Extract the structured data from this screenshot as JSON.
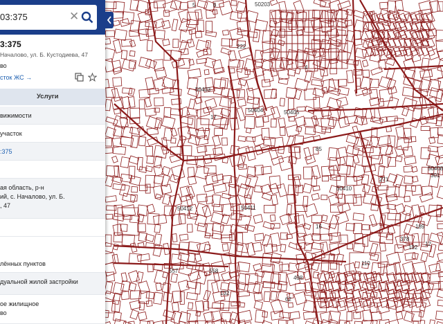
{
  "search": {
    "value": "03:375",
    "clear_icon": "close-icon",
    "search_icon": "search-icon"
  },
  "card": {
    "title": "3:375",
    "address": "Началово, ул. Б. Кустодиева, 47",
    "subtitle": "во",
    "link": "сток ЖС →",
    "actions": [
      "copy-icon",
      "star-icon"
    ]
  },
  "tabs": {
    "services": "Услуги"
  },
  "rows": [
    {
      "lines": [
        "вижимости"
      ],
      "alt": true
    },
    {
      "lines": [
        "участок"
      ],
      "alt": false
    },
    {
      "lines": [
        ":375"
      ],
      "alt": true,
      "blue": true
    },
    {
      "lines": [],
      "alt": false
    },
    {
      "lines": [
        "ая область, р-н",
        "ий, с. Началово, ул. Б.",
        ", 47"
      ],
      "alt": true
    },
    {
      "lines": [],
      "alt": false
    },
    {
      "lines": [
        "лённых пунктов"
      ],
      "alt": false
    },
    {
      "lines": [
        "дуальной жилой застройки"
      ],
      "alt": true
    },
    {
      "lines": [
        "ое жилищное",
        "во"
      ],
      "alt": false
    }
  ],
  "map": {
    "line_color": "#8b1a1a",
    "labels": [
      "6",
      "5",
      "50203",
      "222",
      "50403",
      "17",
      "50404",
      "4",
      "85",
      "50405",
      "50408",
      "301",
      "271",
      "50410",
      "50412",
      "50411",
      "16",
      "189",
      "378",
      "192",
      "12",
      "110",
      "498",
      "557",
      "558",
      "132",
      "62"
    ]
  }
}
